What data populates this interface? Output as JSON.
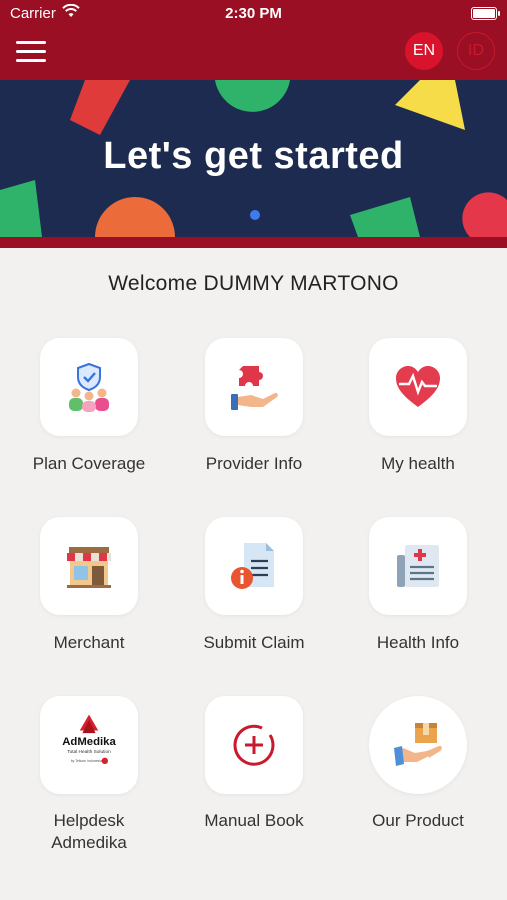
{
  "status_bar": {
    "carrier": "Carrier",
    "time": "2:30 PM"
  },
  "header": {
    "lang_en": "EN",
    "lang_id": "ID"
  },
  "banner": {
    "title": "Let's get started"
  },
  "welcome": "Welcome DUMMY MARTONO",
  "menu": [
    {
      "label": "Plan Coverage",
      "icon": "plan-coverage-icon"
    },
    {
      "label": "Provider Info",
      "icon": "provider-info-icon"
    },
    {
      "label": "My health",
      "icon": "my-health-icon"
    },
    {
      "label": "Merchant",
      "icon": "merchant-icon"
    },
    {
      "label": "Submit Claim",
      "icon": "submit-claim-icon"
    },
    {
      "label": "Health Info",
      "icon": "health-info-icon"
    },
    {
      "label": "Helpdesk Admedika",
      "icon": "admedika-logo"
    },
    {
      "label": "Manual Book",
      "icon": "manual-book-icon"
    },
    {
      "label": "Our Product",
      "icon": "our-product-icon"
    }
  ],
  "logo": {
    "name": "AdMedika",
    "tagline": "Total Health Solution",
    "sub": "by Telkom Indonesia"
  },
  "colors": {
    "brand": "#9a0f23",
    "accent": "#d9132b",
    "banner": "#1e2b50"
  }
}
